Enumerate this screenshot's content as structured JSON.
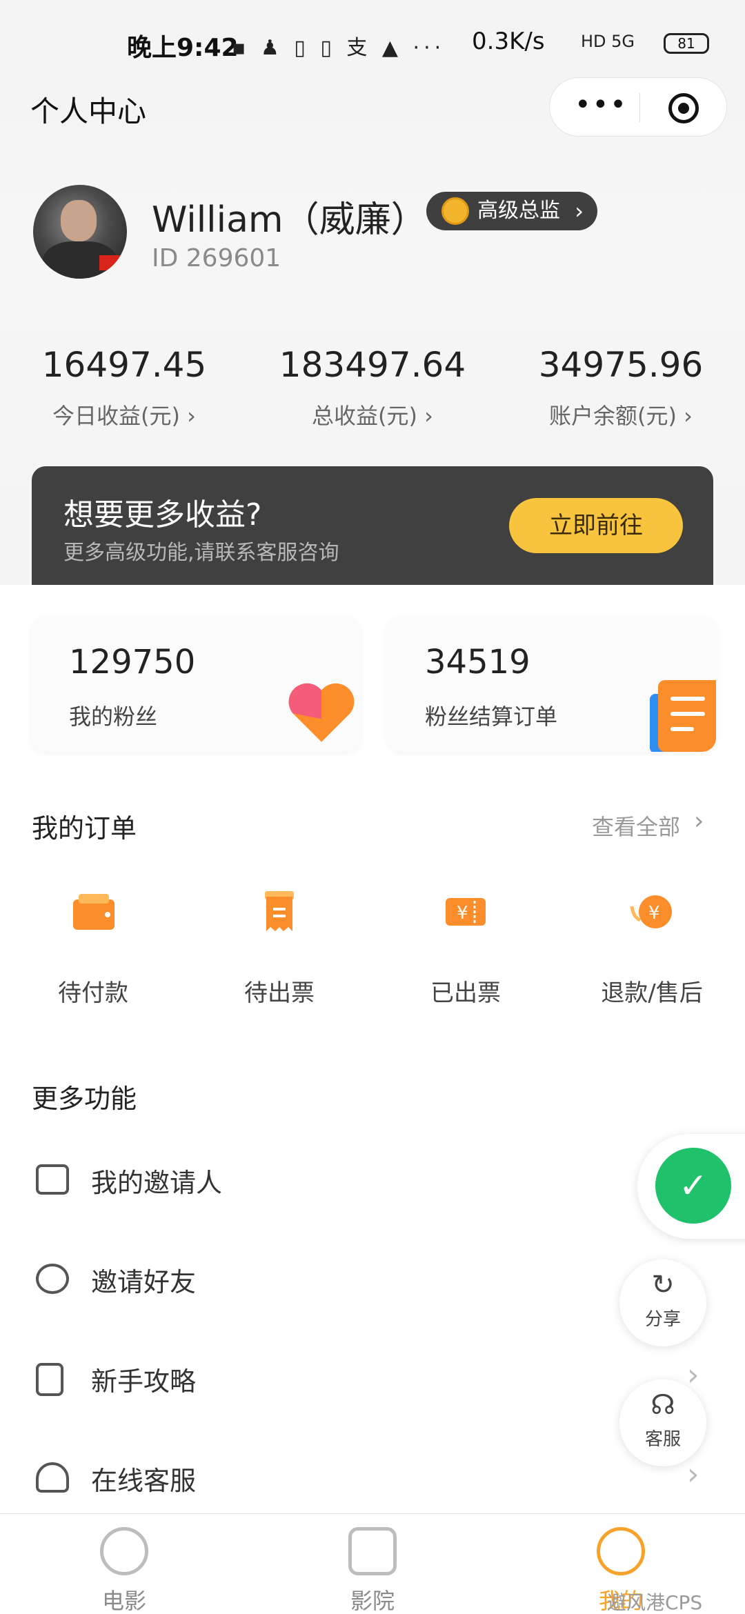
{
  "status_bar": {
    "time": "晚上9:42",
    "icons_text": "▪ ♟ ▯ ▯ 支 ▲ ···",
    "net_speed": "0.3K/s",
    "signal": "HD 5G",
    "battery": "81"
  },
  "nav": {
    "title": "个人中心",
    "menu_icon": "more-dots-icon",
    "close_icon": "target-icon"
  },
  "profile": {
    "name": "William（威廉）",
    "id": "ID 269601",
    "level": "高级总监"
  },
  "stats": [
    {
      "value": "16497.45",
      "label": "今日收益(元) ›"
    },
    {
      "value": "183497.64",
      "label": "总收益(元) ›"
    },
    {
      "value": "34975.96",
      "label": "账户余额(元) ›"
    }
  ],
  "promo": {
    "title": "想要更多收益?",
    "subtitle": "更多高级功能,请联系客服咨询",
    "button": "立即前往"
  },
  "cards": [
    {
      "value": "129750",
      "label": "我的粉丝"
    },
    {
      "value": "34519",
      "label": "粉丝结算订单"
    }
  ],
  "orders": {
    "title": "我的订单",
    "view_all": "查看全部",
    "items": [
      {
        "label": "待付款",
        "icon": "wallet-icon"
      },
      {
        "label": "待出票",
        "icon": "receipt-icon"
      },
      {
        "label": "已出票",
        "icon": "ticket-icon"
      },
      {
        "label": "退款/售后",
        "icon": "refund-icon"
      }
    ]
  },
  "more": {
    "title": "更多功能",
    "items": [
      {
        "label": "我的邀请人",
        "icon": "inbox-icon"
      },
      {
        "label": "邀请好友",
        "icon": "users-icon"
      },
      {
        "label": "新手攻略",
        "icon": "bookmark-icon"
      },
      {
        "label": "在线客服",
        "icon": "headset-icon"
      }
    ]
  },
  "floating": {
    "share": "分享",
    "service": "客服"
  },
  "tabs": [
    {
      "label": "电影",
      "icon": "film-reel-icon"
    },
    {
      "label": "影院",
      "icon": "cinema-seat-icon"
    },
    {
      "label": "我的",
      "icon": "smile-icon"
    }
  ],
  "watermark": "避风港CPS",
  "colors": {
    "accent": "#f7a22a",
    "promo_button": "#f8c33d",
    "green": "#1fc16a",
    "banner": "#404040"
  }
}
